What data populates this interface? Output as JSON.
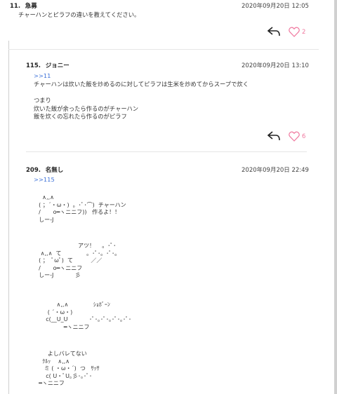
{
  "comments": [
    {
      "number": "11.",
      "name": "急募",
      "date": "2020年09月20日 12:05",
      "body": "チャーハンとピラフの違いを教えてください。",
      "likes": "2",
      "like_color": "#f07aa0"
    },
    {
      "number": "115.",
      "name": "ジョニー",
      "date": "2020年09月20日 13:10",
      "anchor": ">>11",
      "body": "チャーハンは炊いた飯を炒めるのに対してピラフは生米を炒めてからスープで炊く\n\nつまり\n炊いた飯が余ったら作るのがチャーハン\n飯を炊くの忘れたら作るのがピラフ",
      "likes": "6",
      "like_color": "#f07aa0"
    },
    {
      "number": "209.",
      "name": "名無し",
      "date": "2020年09月20日 22:49",
      "anchor": ">>115",
      "aa_blocks": [
        "    ∧,,∧\n  ( ；´・ω・)  。･ﾟ･⌒)  チャーハン\n  /       o━ヽニニフ))   作るよ！！\n  しー-J",
        "                        アツ！    。･ﾟ･\n   ∧,,∧  て              。･ﾟ･。･ﾟ･。\n  ( ；  ﾟωﾟ)  て          ／／\n  /       o━ヽニニフ\n  しー-J            彡",
        "            ∧,,∧              ｼｮﾎﾞｰﾝ\n       ( ´・ω・)\n      c(__U_U            ･ﾟ･｡･ﾟ･｡･ﾟ･｡･ﾟ･\n                ━ヽニニフ",
        "       よしバレてない\n    ｸﾙｯ    ∧,,∧\n     ミ ( ・ω・´)  つ   ｻｯｻ\n      c( U・ﾟU｡彡･｡･ﾟ･\n  ━ヽニニフ"
      ]
    }
  ]
}
